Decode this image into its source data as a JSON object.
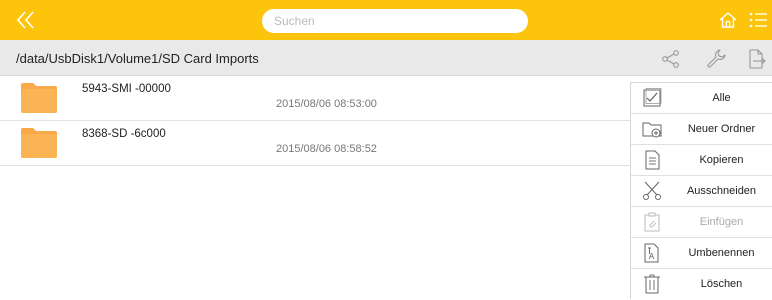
{
  "topbar": {
    "back_icon": "double-chevron-left-icon",
    "search_placeholder": "Suchen",
    "search_value": "",
    "home_icon": "home-icon",
    "menu_icon": "list-menu-icon",
    "bg_color": "#fcc50b"
  },
  "pathbar": {
    "path": "/data/UsbDisk1/Volume1/SD Card Imports",
    "actions": [
      "share-icon",
      "wrench-icon",
      "export-icon"
    ]
  },
  "files": [
    {
      "name": "5943-SMI  -00000",
      "date": "2015/08/06 08:53:00",
      "icon": "folder-icon"
    },
    {
      "name": "8368-SD  -6c000",
      "date": "2015/08/06 08:58:52",
      "icon": "folder-icon"
    }
  ],
  "popup_menu": {
    "items": [
      {
        "label": "Alle",
        "icon": "select-all-icon",
        "enabled": true
      },
      {
        "label": "Neuer Ordner",
        "icon": "new-folder-icon",
        "enabled": true
      },
      {
        "label": "Kopieren",
        "icon": "copy-icon",
        "enabled": true
      },
      {
        "label": "Ausschneiden",
        "icon": "scissors-icon",
        "enabled": true
      },
      {
        "label": "Einfügen",
        "icon": "paste-icon",
        "enabled": false
      },
      {
        "label": "Umbenennen",
        "icon": "rename-icon",
        "enabled": true
      },
      {
        "label": "Löschen",
        "icon": "trash-icon",
        "enabled": true
      }
    ]
  }
}
